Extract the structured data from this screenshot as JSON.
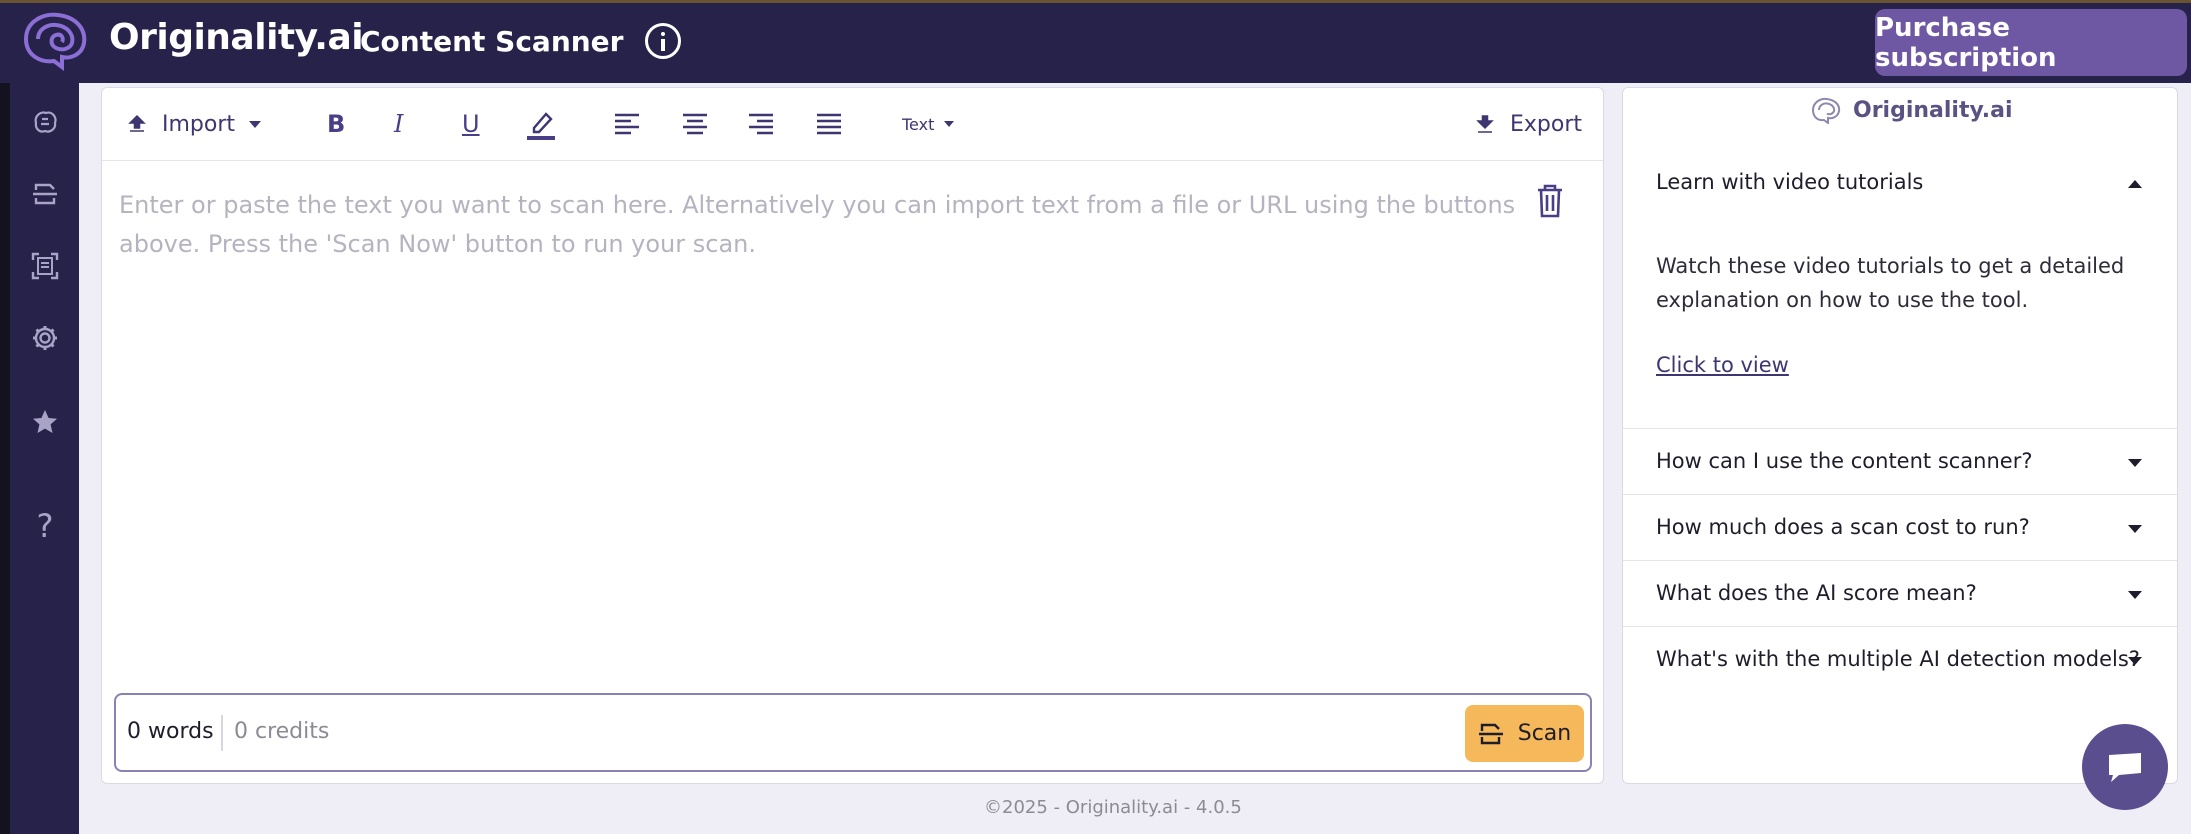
{
  "header": {
    "brand": "Originality.ai",
    "app_title": "Content Scanner",
    "purchase_label": "Purchase subscription"
  },
  "sidebar": {
    "items": [
      {
        "icon": "brain-icon"
      },
      {
        "icon": "scan-icon"
      },
      {
        "icon": "document-scan-icon"
      },
      {
        "icon": "gear-icon"
      },
      {
        "icon": "star-icon"
      },
      {
        "icon": "help-icon",
        "label": "?"
      }
    ]
  },
  "toolbar": {
    "import_label": "Import",
    "text_style_label": "Text",
    "export_label": "Export"
  },
  "editor": {
    "placeholder": "Enter or paste the text you want to scan here. Alternatively you can import text from a file or URL using the buttons above. Press the 'Scan Now' button to run your scan."
  },
  "footer_bar": {
    "words": "0 words",
    "credits": "0 credits",
    "scan_label": "Scan"
  },
  "help": {
    "brand": "Originality.ai",
    "open_title": "Learn with video tutorials",
    "open_body": "Watch these video tutorials to get a detailed explanation on how to use the tool.",
    "open_link": "Click to view",
    "items": [
      "How can I use the content scanner?",
      "How much does a scan cost to run?",
      "What does the AI score mean?",
      "What's with the multiple AI detection models?"
    ]
  },
  "copyright": "©2025 - Originality.ai - 4.0.5",
  "colors": {
    "header_bg": "#27224a",
    "accent": "#6e58a3",
    "scan_button": "#f5b95b"
  }
}
